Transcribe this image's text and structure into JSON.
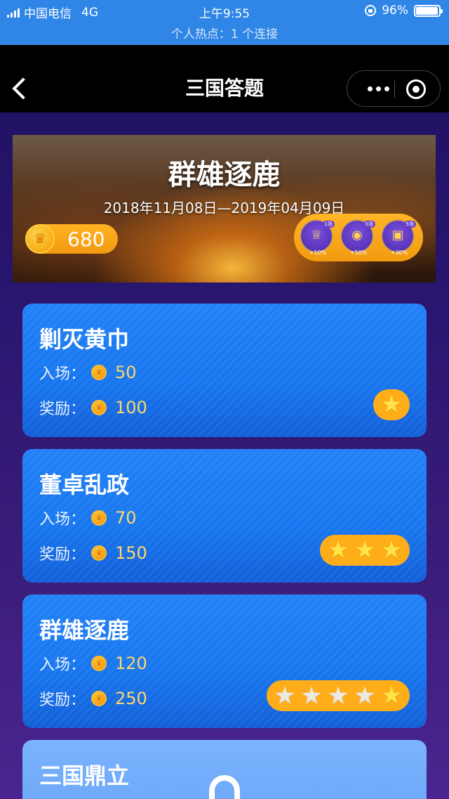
{
  "status_bar": {
    "carrier": "中国电信",
    "network": "4G",
    "time": "上午9:55",
    "battery": "96%",
    "battery_level": 0.96,
    "hotspot": "个人热点：1 个连接"
  },
  "nav": {
    "title": "三国答题",
    "icons": [
      "back-icon",
      "more-icon",
      "target-icon"
    ]
  },
  "banner": {
    "title": "群雄逐鹿",
    "dates": "2018年11月08日—2019年04月09日",
    "coins": "680",
    "boosts": [
      {
        "tag": "1场",
        "pct": "+10%",
        "icon": "trophy-icon"
      },
      {
        "tag": "5场",
        "pct": "+50%",
        "icon": "coins-icon"
      },
      {
        "tag": "5场",
        "pct": "+30%",
        "icon": "card-icon"
      }
    ]
  },
  "labels": {
    "entry": "入场：",
    "reward": "奖励："
  },
  "levels": [
    {
      "title": "剿灭黄巾",
      "entry": "50",
      "reward": "100",
      "stars_filled": 1,
      "stars_total": 1
    },
    {
      "title": "董卓乱政",
      "entry": "70",
      "reward": "150",
      "stars_filled": 3,
      "stars_total": 3
    },
    {
      "title": "群雄逐鹿",
      "entry": "120",
      "reward": "250",
      "stars_filled": 1,
      "stars_total": 5
    },
    {
      "title": "三国鼎立",
      "locked": true
    }
  ],
  "colors": {
    "status_bar": "#2f86e6",
    "card": "#1876ef",
    "accent": "#ffae1a",
    "star": "#ffe34a"
  }
}
